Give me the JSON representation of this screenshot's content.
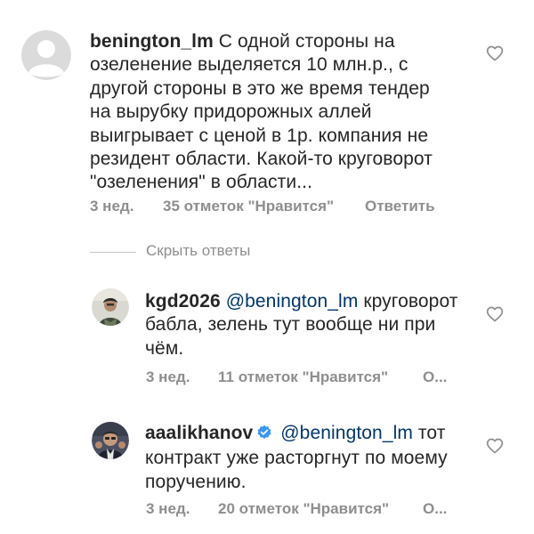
{
  "comments": [
    {
      "username": "benington_lm",
      "text": "С одной стороны на озеленение выделяется 10 млн.р., с другой стороны в это же время тендер на вырубку придорожных аллей выигрывает с ценой в 1р. компания не резидент области. Какой-то круговорот \"озеленения\" в области...",
      "line1_rest": " С одной стороны на",
      "lines": [
        "озеленение выделяется 10 млн.р., с",
        "другой стороны в это же время тендер",
        "на вырубку придорожных аллей",
        "выигрывает с ценой в 1р. компания не",
        "резидент области. Какой-то круговорот",
        "\"озеленения\" в области..."
      ],
      "time": "3 нед.",
      "likes": "35 отметок \"Нравится\"",
      "reply": "Ответить",
      "avatar_icon": "default-avatar-icon",
      "like_icon": "heart-outline-icon"
    }
  ],
  "hide_replies": "Скрыть ответы",
  "replies": [
    {
      "username": "kgd2026",
      "mention": "@benington_lm",
      "line1_rest": " круговорот",
      "lines": [
        "бабла, зелень тут вообще ни при",
        "чём."
      ],
      "time": "3 нед.",
      "likes": "11 отметок \"Нравится\"",
      "reply": "О...",
      "avatar_icon": "user-photo-avatar-icon",
      "like_icon": "heart-outline-icon"
    },
    {
      "username": "aaalikhanov",
      "verified_icon": "verified-badge-icon",
      "mention": "@benington_lm",
      "line1_rest": " тот",
      "lines": [
        "контракт уже расторгнут по моему",
        "поручению."
      ],
      "time": "3 нед.",
      "likes": "20 отметок \"Нравится\"",
      "reply": "О...",
      "avatar_icon": "user-photo-avatar-icon",
      "like_icon": "heart-outline-icon"
    }
  ],
  "colors": {
    "text": "#262626",
    "secondary": "#8e8e8e",
    "mention": "#00376b",
    "verified": "#3897f0"
  }
}
